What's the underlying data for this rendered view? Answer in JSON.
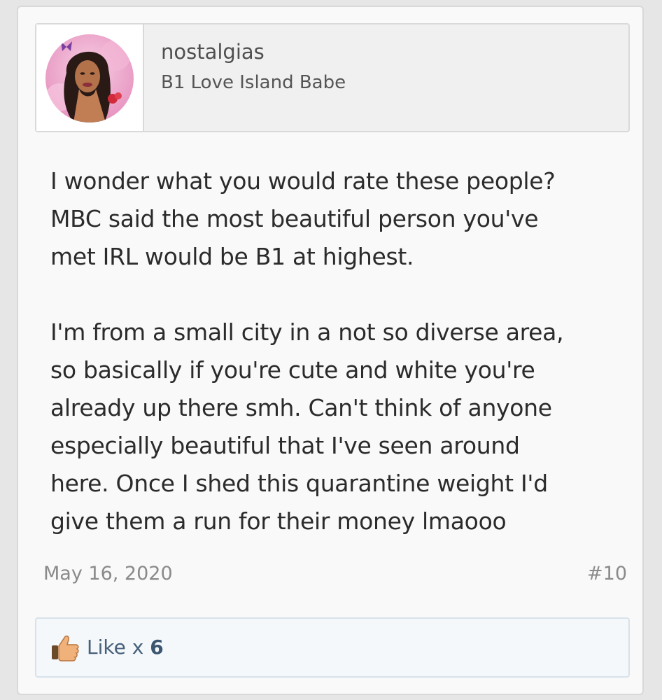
{
  "author": {
    "username": "nostalgias",
    "user_title": "B1 Love Island Babe"
  },
  "message": {
    "lines": [
      "I wonder what you would rate these people?",
      "MBC said the most beautiful person you've",
      "met IRL would be B1 at highest.",
      "",
      "I'm from a small city in a not so diverse area,",
      "so basically if you're cute and white you're",
      "already up there smh. Can't think of anyone",
      "especially beautiful that I've seen around",
      "here. Once I shed this quarantine weight I'd",
      "give them a run for their money lmaooo"
    ]
  },
  "meta": {
    "date": "May 16, 2020",
    "post_number": "#10"
  },
  "likes": {
    "label": "Like x ",
    "count": "6",
    "icon": "thumbs-up-icon"
  },
  "colors": {
    "link": "#47617a",
    "muted": "#8a8a8a",
    "text": "#2b2b2b"
  }
}
